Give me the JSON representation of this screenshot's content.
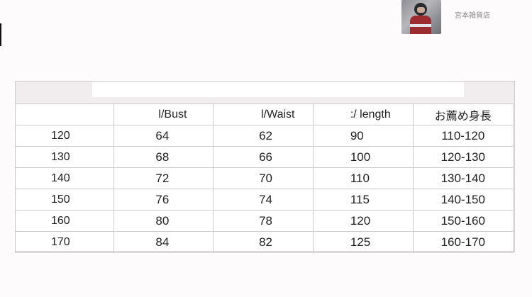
{
  "shop": {
    "name": "宮本雑貨店"
  },
  "size_table": {
    "headers": [
      "",
      "l/Bust",
      "l/Waist",
      ":/ length",
      "お薦め身長"
    ],
    "rows": [
      [
        "120",
        "64",
        "62",
        "90",
        "110-120"
      ],
      [
        "130",
        "68",
        "66",
        "100",
        "120-130"
      ],
      [
        "140",
        "72",
        "70",
        "110",
        "130-140"
      ],
      [
        "150",
        "76",
        "74",
        "115",
        "140-150"
      ],
      [
        "160",
        "80",
        "78",
        "120",
        "150-160"
      ],
      [
        "170",
        "84",
        "82",
        "125",
        "160-170"
      ]
    ]
  }
}
